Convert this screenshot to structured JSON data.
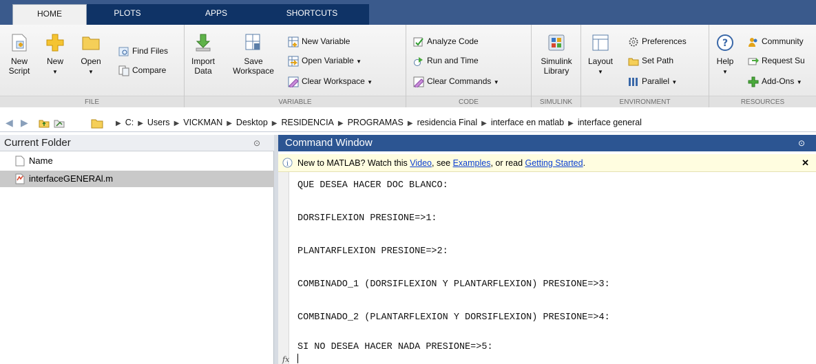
{
  "tabs": [
    "HOME",
    "PLOTS",
    "APPS",
    "SHORTCUTS"
  ],
  "ribbon": {
    "file": {
      "label": "FILE",
      "new_script": [
        "New",
        "Script"
      ],
      "new": "New",
      "open": "Open",
      "find_files": "Find Files",
      "compare": "Compare"
    },
    "variable": {
      "label": "VARIABLE",
      "import_data": [
        "Import",
        "Data"
      ],
      "save_workspace": [
        "Save",
        "Workspace"
      ],
      "new_variable": "New Variable",
      "open_variable": "Open Variable",
      "clear_workspace": "Clear Workspace"
    },
    "code": {
      "label": "CODE",
      "analyze_code": "Analyze Code",
      "run_and_time": "Run and Time",
      "clear_commands": "Clear Commands"
    },
    "simulink": {
      "label": "SIMULINK",
      "simulink_library": [
        "Simulink",
        "Library"
      ]
    },
    "environment": {
      "label": "ENVIRONMENT",
      "layout": "Layout",
      "preferences": "Preferences",
      "set_path": "Set Path",
      "parallel": "Parallel"
    },
    "resources": {
      "label": "RESOURCES",
      "help": "Help",
      "community": "Community",
      "request_support": "Request Su",
      "add_ons": "Add-Ons"
    }
  },
  "path": [
    "C:",
    "Users",
    "VICKMAN",
    "Desktop",
    "RESIDENCIA",
    "PROGRAMAS",
    "residencia Final",
    "interface en matlab",
    "interface general"
  ],
  "current_folder": {
    "title": "Current Folder",
    "column_name": "Name",
    "files": [
      "interfaceGENERAl.m"
    ]
  },
  "command_window": {
    "title": "Command Window",
    "notice_prefix": "New to MATLAB? Watch this ",
    "notice_video": "Video",
    "notice_mid1": ", see ",
    "notice_examples": "Examples",
    "notice_mid2": ", or read ",
    "notice_getting_started": "Getting Started",
    "notice_suffix": ".",
    "lines": [
      "QUE DESEA HACER DOC BLANCO:",
      "DORSIFLEXION PRESIONE=>1:",
      "PLANTARFLEXION PRESIONE=>2:",
      "COMBINADO_1 (DORSIFLEXION Y PLANTARFLEXION) PRESIONE=>3:",
      "COMBINADO_2 (PLANTARFLEXION Y DORSIFLEXION) PRESIONE=>4:",
      "SI NO DESEA HACER NADA PRESIONE=>5:"
    ],
    "prompt_symbol": "fx"
  },
  "colors": {
    "tabstrip": "#3a5a8c",
    "command_title": "#2c5592",
    "link": "#0b3fd1",
    "selected_row": "#c9c9c9"
  }
}
